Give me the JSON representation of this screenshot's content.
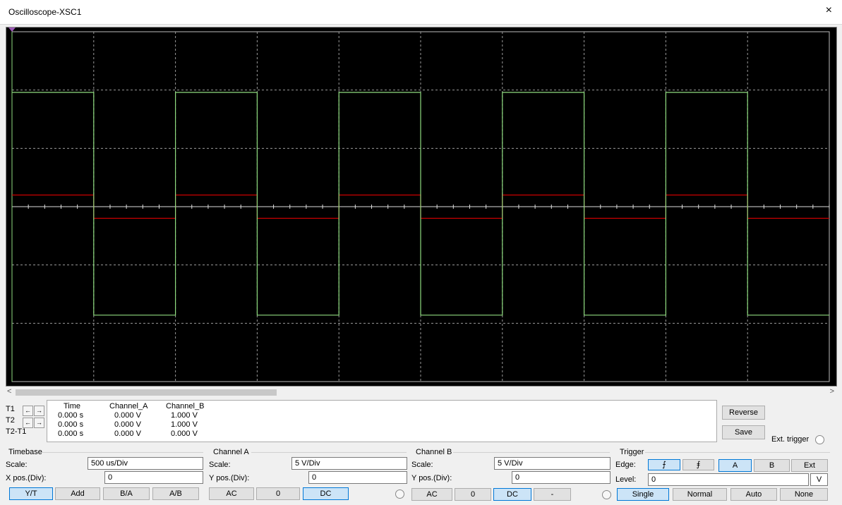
{
  "window": {
    "title": "Oscilloscope-XSC1",
    "close_icon": "×"
  },
  "scope": {
    "background": "#000000",
    "grid_color": "#9a9a9a",
    "channel_a_color": "#cc0000",
    "channel_b_color": "#8fdc7f",
    "divisions_x": 10,
    "divisions_y": 6
  },
  "chart_data": {
    "type": "line",
    "xlim_div": [
      0,
      10
    ],
    "ylim_div": [
      -3,
      3
    ],
    "series": [
      {
        "name": "Channel_A",
        "color": "#cc0000",
        "points": [
          [
            0,
            0.2
          ],
          [
            1,
            0.2
          ],
          [
            1,
            -0.2
          ],
          [
            2,
            -0.2
          ],
          [
            2,
            0.2
          ],
          [
            3,
            0.2
          ],
          [
            3,
            -0.2
          ],
          [
            4,
            -0.2
          ],
          [
            4,
            0.2
          ],
          [
            5,
            0.2
          ],
          [
            5,
            -0.2
          ],
          [
            6,
            -0.2
          ],
          [
            6,
            0.2
          ],
          [
            7,
            0.2
          ],
          [
            7,
            -0.2
          ],
          [
            8,
            -0.2
          ],
          [
            8,
            0.2
          ],
          [
            9,
            0.2
          ],
          [
            9,
            -0.2
          ],
          [
            10,
            -0.2
          ]
        ]
      },
      {
        "name": "Channel_B",
        "color": "#8fdc7f",
        "points": [
          [
            0,
            1.96
          ],
          [
            1,
            1.96
          ],
          [
            1,
            -1.86
          ],
          [
            2,
            -1.86
          ],
          [
            2,
            1.96
          ],
          [
            3,
            1.96
          ],
          [
            3,
            -1.86
          ],
          [
            4,
            -1.86
          ],
          [
            4,
            1.96
          ],
          [
            5,
            1.96
          ],
          [
            5,
            -1.86
          ],
          [
            6,
            -1.86
          ],
          [
            6,
            1.96
          ],
          [
            7,
            1.96
          ],
          [
            7,
            -1.86
          ],
          [
            8,
            -1.86
          ],
          [
            8,
            1.96
          ],
          [
            9,
            1.96
          ],
          [
            9,
            -1.86
          ],
          [
            10,
            -1.86
          ]
        ]
      }
    ]
  },
  "readout": {
    "headers": {
      "time": "Time",
      "channel_a": "Channel_A",
      "channel_b": "Channel_B"
    },
    "rows": [
      {
        "label": "T1",
        "time": "0.000 s",
        "a": "0.000 V",
        "b": "1.000 V"
      },
      {
        "label": "T2",
        "time": "0.000 s",
        "a": "0.000 V",
        "b": "1.000 V"
      },
      {
        "label": "T2-T1",
        "time": "0.000 s",
        "a": "0.000 V",
        "b": "0.000 V"
      }
    ],
    "arrow_left": "←",
    "arrow_right": "→"
  },
  "buttons": {
    "reverse": "Reverse",
    "save": "Save",
    "ext_trigger": "Ext. trigger"
  },
  "timebase": {
    "label": "Timebase",
    "scale_label": "Scale:",
    "scale_value": "500 us/Div",
    "xpos_label": "X pos.(Div):",
    "xpos_value": "0",
    "modes": [
      "Y/T",
      "Add",
      "B/A",
      "A/B"
    ],
    "active_mode": "Y/T"
  },
  "channel_a": {
    "label": "Channel A",
    "scale_label": "Scale:",
    "scale_value": "5  V/Div",
    "ypos_label": "Y pos.(Div):",
    "ypos_value": "0",
    "coupling": [
      "AC",
      "0",
      "DC"
    ],
    "active_coupling": "DC"
  },
  "channel_b": {
    "label": "Channel B",
    "scale_label": "Scale:",
    "scale_value": "5  V/Div",
    "ypos_label": "Y pos.(Div):",
    "ypos_value": "0",
    "coupling": [
      "AC",
      "0",
      "DC",
      "-"
    ],
    "active_coupling": "DC"
  },
  "trigger": {
    "label": "Trigger",
    "edge_label": "Edge:",
    "edge_rising": "⨍",
    "edge_falling": "⨎",
    "sources": [
      "A",
      "B",
      "Ext"
    ],
    "active_source": "A",
    "level_label": "Level:",
    "level_value": "0",
    "level_unit": "V",
    "modes": [
      "Single",
      "Normal",
      "Auto",
      "None"
    ],
    "active_mode": "Single"
  }
}
